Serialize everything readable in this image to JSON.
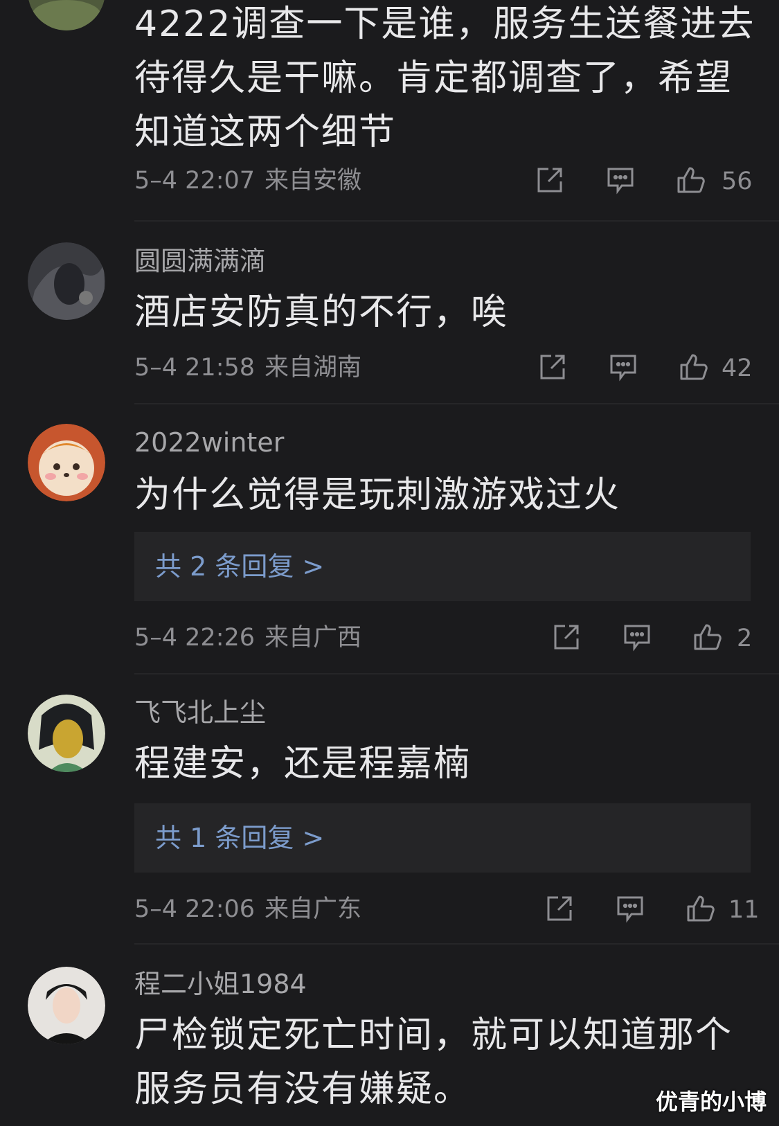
{
  "comments": [
    {
      "username": "",
      "content": "4222调查一下是谁，服务生送餐进去待得久是干嘛。肯定都调查了，希望知道这两个细节",
      "time": "5–4 22:07",
      "location": "来自安徽",
      "likes": "56",
      "replies": ""
    },
    {
      "username": "圆圆满满滴",
      "content": "酒店安防真的不行，唉",
      "time": "5–4 21:58",
      "location": "来自湖南",
      "likes": "42",
      "replies": ""
    },
    {
      "username": "2022winter",
      "content": "为什么觉得是玩刺激游戏过火",
      "time": "5–4 22:26",
      "location": "来自广西",
      "likes": "2",
      "replies": "共 2 条回复 >"
    },
    {
      "username": "飞飞北上尘",
      "content": "程建安，还是程嘉楠",
      "time": "5–4 22:06",
      "location": "来自广东",
      "likes": "11",
      "replies": "共 1 条回复 >"
    },
    {
      "username": "程二小姐1984",
      "content": "尸检锁定死亡时间，就可以知道那个服务员有没有嫌疑。",
      "time": "",
      "location": "",
      "likes": "",
      "replies": ""
    }
  ],
  "icons": {
    "share": "share-icon",
    "comment": "comment-icon",
    "like": "thumbs-up-icon"
  },
  "watermark": "优青的小博",
  "colors": {
    "background": "#1b1b1d",
    "reply_box": "#252527",
    "reply_link": "#7c9ccc",
    "meta": "#8e8e92"
  }
}
